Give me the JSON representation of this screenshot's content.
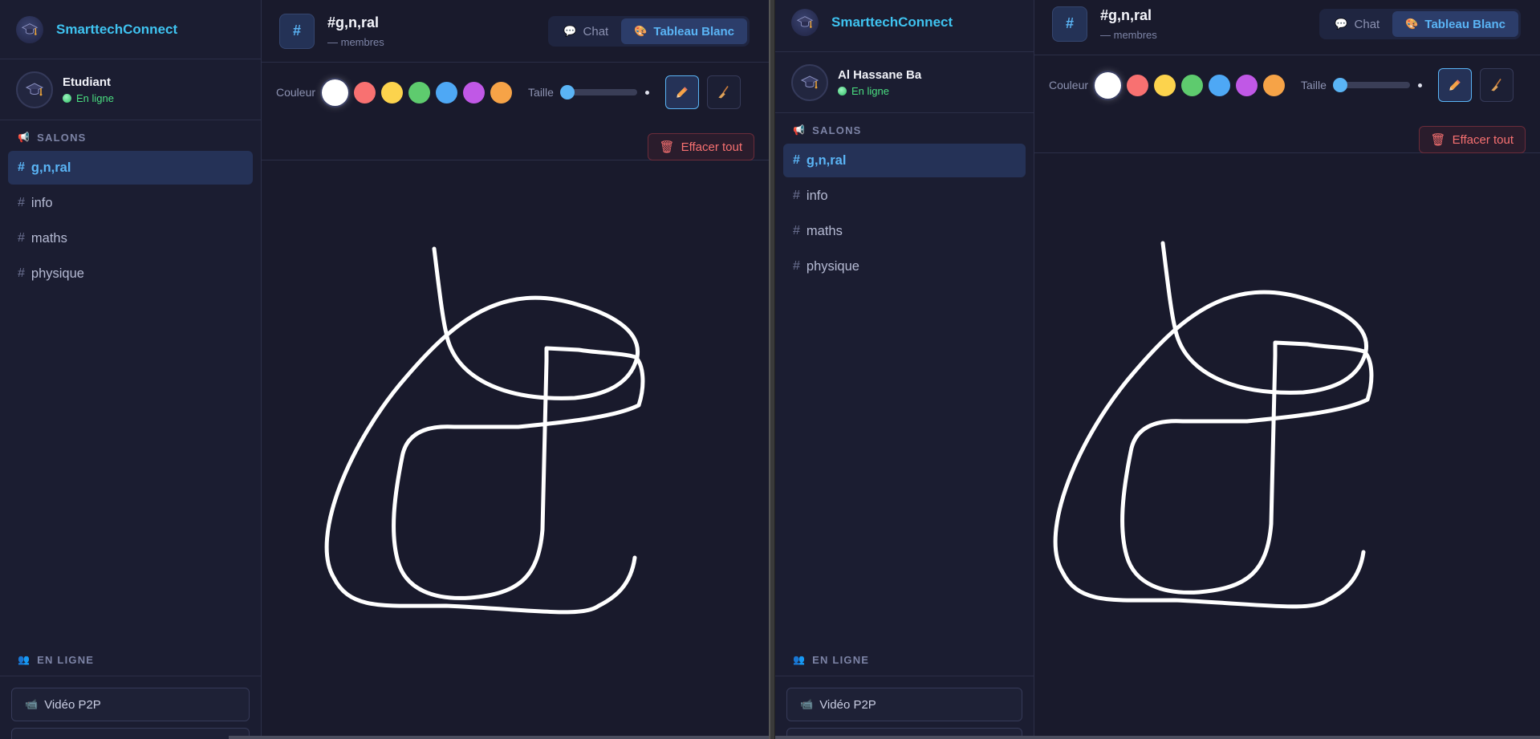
{
  "windows": [
    {
      "brand": "SmarttechConnect",
      "user": {
        "name": "Etudiant",
        "status": "En ligne"
      },
      "salons_title": "SALONS",
      "channels": [
        {
          "hash": "#",
          "name": "g,n,ral",
          "active": true
        },
        {
          "hash": "#",
          "name": "info"
        },
        {
          "hash": "#",
          "name": "maths"
        },
        {
          "hash": "#",
          "name": "physique"
        }
      ],
      "online_title": "EN LIGNE",
      "video_button": "Vidéo P2P",
      "room": {
        "icon": "#",
        "name": "#g,n,ral",
        "members": "— membres"
      },
      "tabs": [
        {
          "label": "Chat",
          "icon": "speech-bubble-icon"
        },
        {
          "label": "Tableau Blanc",
          "icon": "palette-icon",
          "active": true
        }
      ],
      "toolbar": {
        "color_label": "Couleur",
        "size_label": "Taille",
        "clear_label": "Effacer tout"
      }
    },
    {
      "brand": "SmarttechConnect",
      "user": {
        "name": "Al Hassane Ba",
        "status": "En ligne"
      },
      "salons_title": "SALONS",
      "channels": [
        {
          "hash": "#",
          "name": "g,n,ral",
          "active": true
        },
        {
          "hash": "#",
          "name": "info"
        },
        {
          "hash": "#",
          "name": "maths"
        },
        {
          "hash": "#",
          "name": "physique"
        }
      ],
      "online_title": "EN LIGNE",
      "video_button": "Vidéo P2P",
      "room": {
        "icon": "#",
        "name": "#g,n,ral",
        "members": "— membres"
      },
      "tabs": [
        {
          "label": "Chat",
          "icon": "speech-bubble-icon"
        },
        {
          "label": "Tableau Blanc",
          "icon": "palette-icon",
          "active": true
        }
      ],
      "toolbar": {
        "color_label": "Couleur",
        "size_label": "Taille",
        "clear_label": "Effacer tout"
      }
    }
  ],
  "palette": [
    "#ffffff",
    "#f87171",
    "#fcd34d",
    "#5ecb6e",
    "#4ea8f5",
    "#c058e6",
    "#f6a347"
  ],
  "selected_color": "#ffffff",
  "accent_color": "#5ab4f5",
  "brand_color": "#3fc3f0",
  "online_color": "#4ade80",
  "danger_color": "#f87171"
}
